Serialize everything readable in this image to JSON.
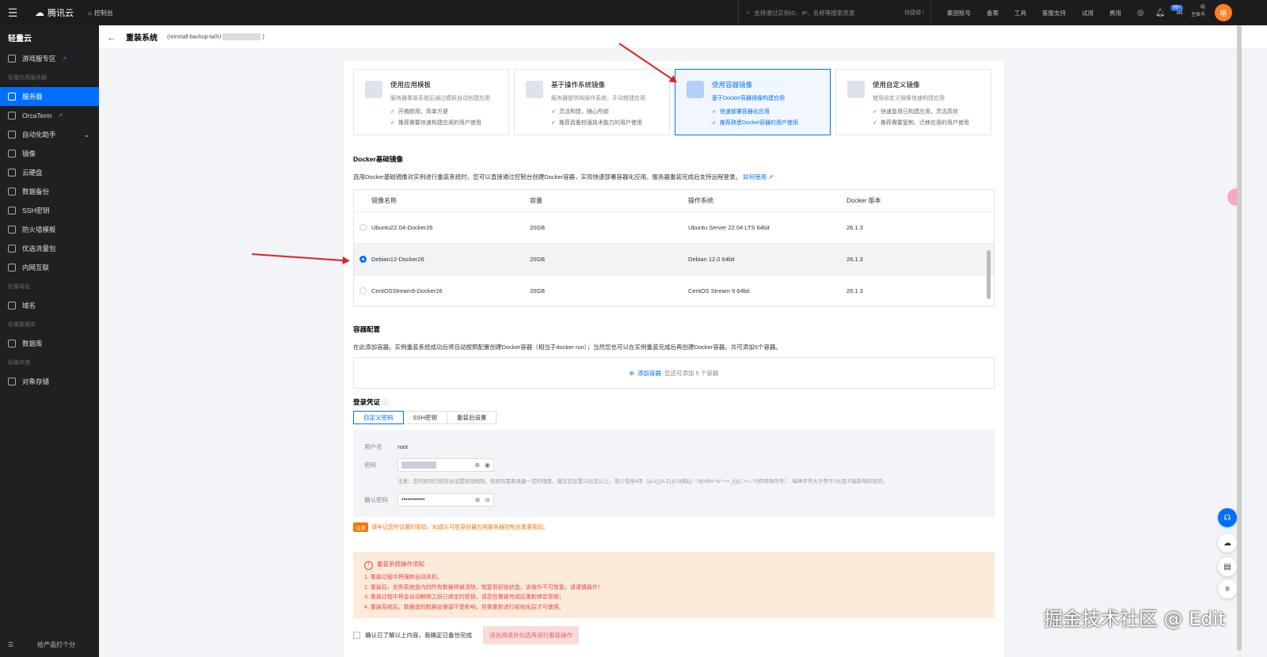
{
  "topbar": {
    "brand": "腾讯云",
    "console": "控制台",
    "search_placeholder": "支持通过实例ID、IP、名称等搜索资源",
    "shortcut": "快捷键 /",
    "links": [
      "集团账号",
      "备案",
      "工具",
      "客服支持",
      "试用",
      "费用"
    ],
    "notification_count": "99+",
    "account_line1": "唔",
    "account_line2": "主账号",
    "avatar_text": "唔"
  },
  "sidebar": {
    "title": "轻量云",
    "items": [
      {
        "type": "item",
        "label": "游戏服专区",
        "ext": true
      },
      {
        "type": "group",
        "label": "轻量应用服务器"
      },
      {
        "type": "item",
        "label": "服务器",
        "active": true
      },
      {
        "type": "item",
        "label": "OrcaTerm",
        "ext": true
      },
      {
        "type": "item",
        "label": "自动化助手",
        "chevron": true
      },
      {
        "type": "item",
        "label": "镜像"
      },
      {
        "type": "item",
        "label": "云硬盘"
      },
      {
        "type": "item",
        "label": "数据备份"
      },
      {
        "type": "item",
        "label": "SSH密钥"
      },
      {
        "type": "item",
        "label": "防火墙模板"
      },
      {
        "type": "item",
        "label": "优选流量包"
      },
      {
        "type": "item",
        "label": "内网互联"
      },
      {
        "type": "group",
        "label": "轻量域名"
      },
      {
        "type": "item",
        "label": "域名"
      },
      {
        "type": "group",
        "label": "轻量数据库"
      },
      {
        "type": "item",
        "label": "数据库"
      },
      {
        "type": "group",
        "label": "轻量存储"
      },
      {
        "type": "item",
        "label": "对象存储"
      }
    ],
    "footer": "给产品打个分"
  },
  "page": {
    "title": "重装系统",
    "instance": "(reinstall-backup-ta0U",
    "instance_end": ")"
  },
  "options": [
    {
      "title": "使用应用模板",
      "desc": "服务器重装系统后通过模板自动创建应用",
      "bullets": [
        "开箱即用，简单方便",
        "推荐需要快速构建应用的用户使用"
      ],
      "selected": false
    },
    {
      "title": "基于操作系统镜像",
      "desc": "服务器提供纯操作系统，手动搭建应用",
      "bullets": [
        "灵活构建，随心所欲",
        "推荐具备较强技术能力的用户使用"
      ],
      "selected": false
    },
    {
      "title": "使用容器镜像",
      "desc": "基于Docker容器镜像构建应用",
      "bullets": [
        "快速部署容器化应用",
        "推荐熟悉Docker容器的用户使用"
      ],
      "selected": true
    },
    {
      "title": "使用自定义镜像",
      "desc": "使用自定义镜像快速构建应用",
      "bullets": [
        "快速复用已构建应用，灵活高效",
        "推荐需要复制、迁移应用的用户使用"
      ],
      "selected": false
    }
  ],
  "docker": {
    "title": "Docker基础镜像",
    "desc": "选用Docker基础镜像对实例进行重装系统时，您可以直接通过控制台创建Docker容器，实现快速部署容器化应用。服务器重装完成后支持远程登录。",
    "link": "如何使用",
    "columns": [
      "镜像名称",
      "容量",
      "操作系统",
      "Docker 版本"
    ],
    "rows": [
      {
        "name": "Ubuntu22.04-Docker26",
        "size": "20GB",
        "os": "Ubuntu Server 22.04 LTS 64bit",
        "version": "26.1.3",
        "selected": false
      },
      {
        "name": "Debian12-Docker26",
        "size": "20GB",
        "os": "Debian 12.0 64bit",
        "version": "26.1.3",
        "selected": true
      },
      {
        "name": "CentOSStream9-Docker26",
        "size": "20GB",
        "os": "CentOS Stream 9 64bit",
        "version": "26.1.3",
        "selected": false
      }
    ]
  },
  "container": {
    "title": "容器配置",
    "desc": "在此添加容器。实例重装系统成功后将自动按照配置创建Docker容器（相当于docker run）；当然您也可以在实例重装完成后再创建Docker容器。共可添加5个容器。",
    "add_label": "添加容器",
    "add_hint": "您还可添加 5 个容器"
  },
  "login": {
    "title": "登录凭证",
    "tabs": [
      "自定义密码",
      "SSH密钥",
      "重装后设置"
    ],
    "username_label": "用户名",
    "username": "root",
    "password_label": "密码",
    "password_note": "注意：您的密码已经符合设置密码规则，但密码需要具备一定的强度，建议您设置12位及以上，至少包括4项（[a-z],[A-Z],[0-9]和[()`~!@#$%^&*-+=_|{}[]:;'<>,.?/]的特殊符号）, 每种字符大于等于2位且不能影响的密码。",
    "confirm_label": "确认密码",
    "confirm_value": "••••••••••••",
    "warn_tag": "注意",
    "warn_text": "请牢记您所设置的密码，如遗忘可登录轻量应用服务器控制台重置密码。"
  },
  "notice": {
    "title": "重装系统操作须知",
    "items": [
      "1. 重装过程中将强制自动关机；",
      "2. 重装后，实例系统盘内的所有数据将被清除，恢复到初始状态，该操作不可恢复，请谨慎操作！",
      "3. 重装过程中将会自动解绑之前已绑定的密钥，请您在重装完成后重新绑定密钥；",
      "4. 重装系统后，数据盘的数据会保留不受影响，但需重新进行初始化后才可使用。"
    ]
  },
  "confirm": {
    "checkbox_label": "确认已了解以上内容，我确定已备份完成",
    "button": "请先阅读并勾选再进行重装操作"
  },
  "watermark": "掘金技术社区 @ Edit",
  "colors": {
    "accent": "#006eff",
    "warning": "#ff7200",
    "danger": "#e54545"
  }
}
